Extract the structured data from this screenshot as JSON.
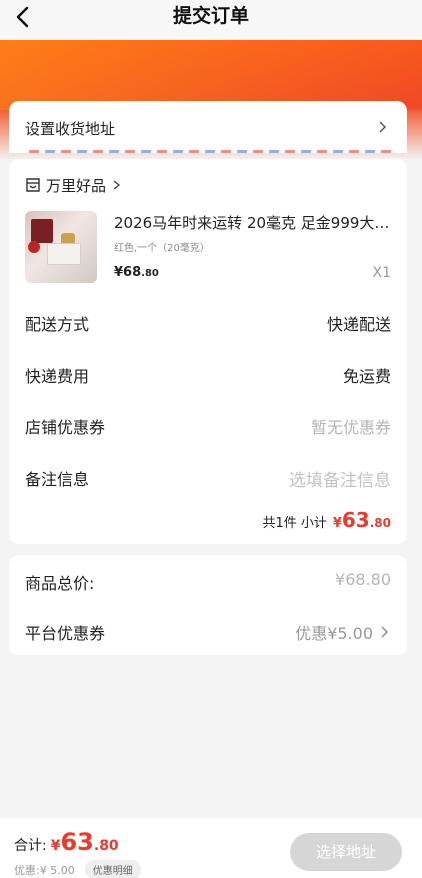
{
  "header": {
    "title": "提交订单",
    "back_icon": "chevron-left-icon"
  },
  "address": {
    "label": "设置收货地址"
  },
  "shop": {
    "name": "万里好品",
    "icon": "shop-icon"
  },
  "product": {
    "title": "2026马年时来运转 20毫克 足金999大…",
    "spec": "红色,一个（20毫克）",
    "price_symbol": "¥",
    "price_int": "68",
    "price_dec": ".80",
    "quantity": "X1"
  },
  "order_rows": {
    "delivery": {
      "label": "配送方式",
      "value": "快递配送"
    },
    "shipping": {
      "label": "快递费用",
      "value": "免运费"
    },
    "store_coupon": {
      "label": "店铺优惠券",
      "value": "暂无优惠券"
    },
    "remark": {
      "label": "备注信息",
      "placeholder": "选填备注信息"
    }
  },
  "subtotal": {
    "prefix": "共1件 小计",
    "symbol": "¥",
    "int": "63",
    "dec": ".80"
  },
  "summary": {
    "goods_total": {
      "label": "商品总价:",
      "value": "¥68.80"
    },
    "platform_coupon": {
      "label": "平台优惠券",
      "value": "优惠¥5.00"
    }
  },
  "footer": {
    "total_label": "合计:",
    "symbol": "¥",
    "total_int": "63",
    "total_dec": ".80",
    "discount": "优惠:¥ 5.00",
    "discount_detail": "优惠明细",
    "action_label": "选择地址"
  },
  "colors": {
    "accent_red": "#e83b2e",
    "banner_orange": "#ff6a1a",
    "disabled_button": "#d6d6d6"
  }
}
